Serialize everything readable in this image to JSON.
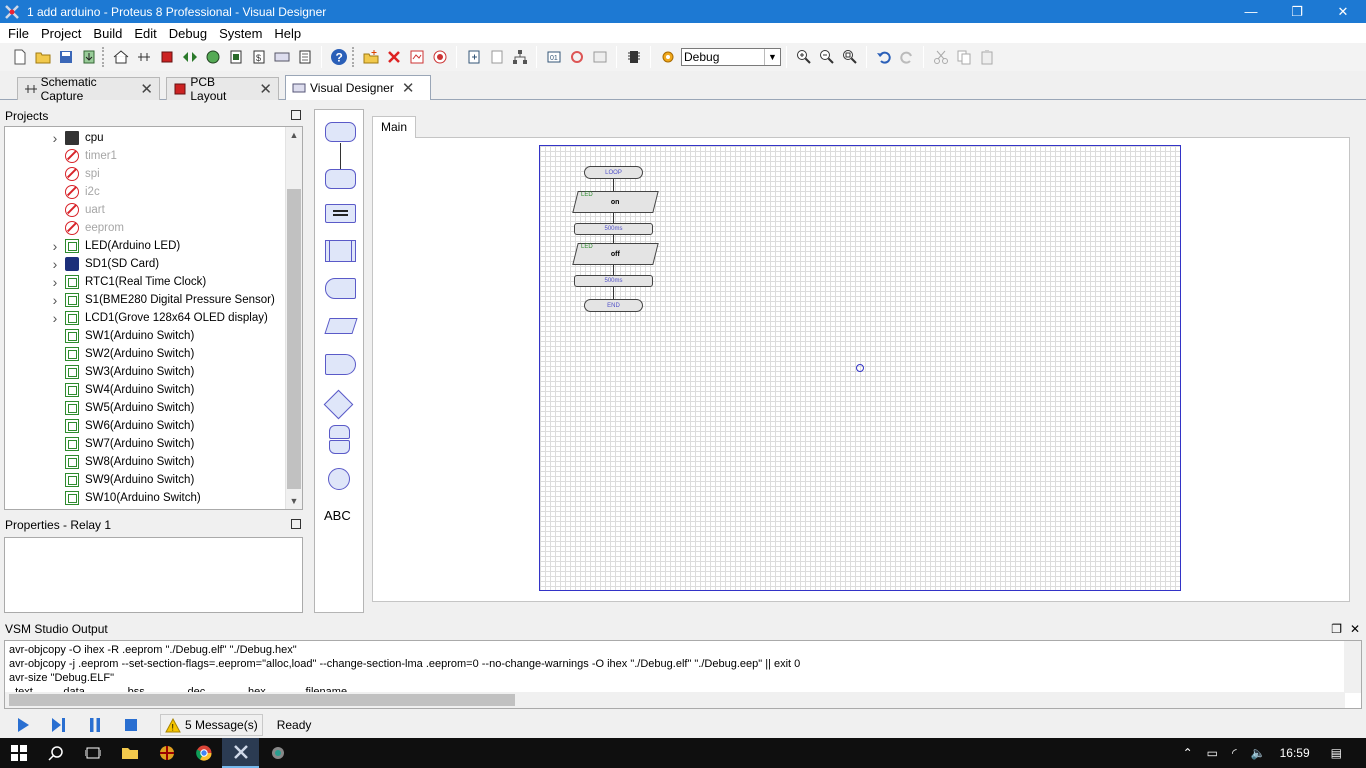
{
  "window": {
    "title": "1 add arduino - Proteus 8 Professional - Visual Designer",
    "minimize": "—",
    "restore": "❐",
    "close": "✕"
  },
  "menu": [
    "File",
    "Project",
    "Build",
    "Edit",
    "Debug",
    "System",
    "Help"
  ],
  "toolbar": {
    "config_value": "Debug"
  },
  "tabs": [
    {
      "label": "Schematic Capture",
      "active": false
    },
    {
      "label": "PCB Layout",
      "active": false
    },
    {
      "label": "Visual Designer",
      "active": true
    }
  ],
  "projects": {
    "title": "Projects",
    "items": [
      {
        "label": "cpu",
        "icon": "chip-icon",
        "expandable": true,
        "muted": false
      },
      {
        "label": "timer1",
        "icon": "blocked-icon",
        "expandable": false,
        "muted": true
      },
      {
        "label": "spi",
        "icon": "blocked-icon",
        "expandable": false,
        "muted": true
      },
      {
        "label": "i2c",
        "icon": "blocked-icon",
        "expandable": false,
        "muted": true
      },
      {
        "label": "uart",
        "icon": "blocked-icon",
        "expandable": false,
        "muted": true
      },
      {
        "label": "eeprom",
        "icon": "blocked-icon",
        "expandable": false,
        "muted": true
      },
      {
        "label": "LED(Arduino LED)",
        "icon": "board-icon",
        "expandable": true,
        "muted": false
      },
      {
        "label": "SD1(SD Card)",
        "icon": "sd-card-icon",
        "expandable": true,
        "muted": false
      },
      {
        "label": "RTC1(Real Time Clock)",
        "icon": "board-icon",
        "expandable": true,
        "muted": false
      },
      {
        "label": "S1(BME280 Digital Pressure Sensor)",
        "icon": "board-icon",
        "expandable": true,
        "muted": false
      },
      {
        "label": "LCD1(Grove 128x64 OLED display)",
        "icon": "board-icon",
        "expandable": true,
        "muted": false
      },
      {
        "label": "SW1(Arduino Switch)",
        "icon": "board-icon",
        "expandable": false,
        "muted": false
      },
      {
        "label": "SW2(Arduino Switch)",
        "icon": "board-icon",
        "expandable": false,
        "muted": false
      },
      {
        "label": "SW3(Arduino Switch)",
        "icon": "board-icon",
        "expandable": false,
        "muted": false
      },
      {
        "label": "SW4(Arduino Switch)",
        "icon": "board-icon",
        "expandable": false,
        "muted": false
      },
      {
        "label": "SW5(Arduino Switch)",
        "icon": "board-icon",
        "expandable": false,
        "muted": false
      },
      {
        "label": "SW6(Arduino Switch)",
        "icon": "board-icon",
        "expandable": false,
        "muted": false
      },
      {
        "label": "SW7(Arduino Switch)",
        "icon": "board-icon",
        "expandable": false,
        "muted": false
      },
      {
        "label": "SW8(Arduino Switch)",
        "icon": "board-icon",
        "expandable": false,
        "muted": false
      },
      {
        "label": "SW9(Arduino Switch)",
        "icon": "board-icon",
        "expandable": false,
        "muted": false
      },
      {
        "label": "SW10(Arduino Switch)",
        "icon": "board-icon",
        "expandable": false,
        "muted": false
      }
    ]
  },
  "properties": {
    "title": "Properties - Relay 1"
  },
  "palette": {
    "text_tool": "ABC"
  },
  "designer": {
    "tab": "Main",
    "flowchart": {
      "loop": "LOOP",
      "step1_tag": "LED",
      "step1": "on",
      "delay1": "500ms",
      "step2_tag": "LED",
      "step2": "off",
      "delay2": "500ms",
      "end": "END"
    }
  },
  "output": {
    "title": "VSM Studio Output",
    "lines": [
      "avr-objcopy -O ihex -R .eeprom \"./Debug.elf\" \"./Debug.hex\"",
      "avr-objcopy -j .eeprom --set-section-flags=.eeprom=\"alloc,load\" --change-section-lma .eeprom=0 --no-change-warnings -O ihex \"./Debug.elf\" \"./Debug.eep\" || exit 0",
      "avr-size \"Debug.ELF\"",
      "  text          data              bss              dec              hex             filename"
    ]
  },
  "status": {
    "messages": "5 Message(s)",
    "text": "Ready"
  },
  "taskbar": {
    "time": "16:59"
  },
  "colors": {
    "titlebar": "#1d79d3",
    "grid_border": "#3333c7",
    "taskbar": "#0f0f0f"
  }
}
